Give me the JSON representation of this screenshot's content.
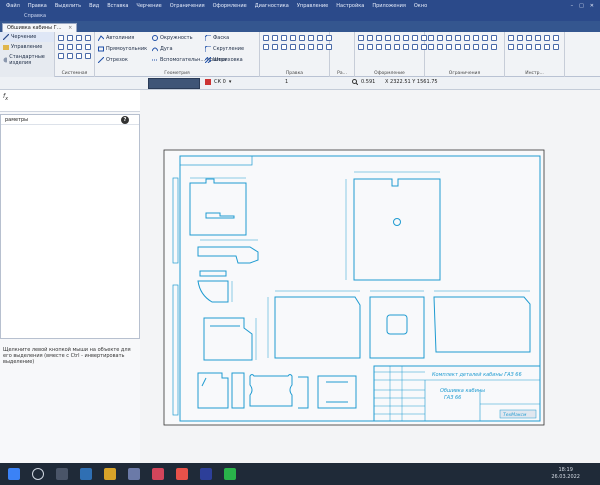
{
  "menu": {
    "items": [
      "Файл",
      "Правка",
      "Выделить",
      "Вид",
      "Вставка",
      "Черчение",
      "Ограничения",
      "Оформление",
      "Диагностика",
      "Управление",
      "Настройка",
      "Приложения",
      "Окно"
    ],
    "subtitle": "Справка"
  },
  "tab": {
    "title": "Обшивка кабины Г..."
  },
  "ribbon": {
    "mode_label": "Черчение",
    "manage_label": "Управление",
    "std_label": "Стандартные изделия",
    "group_system": "Системная",
    "autoline": "Автолиния",
    "rectangle": "Прямоугольник",
    "segment": "Отрезок",
    "circle": "Окружность",
    "arc": "Дуга",
    "aux_line": "Вспомогательн... прямая",
    "chamfer": "Фаска",
    "fillet": "Скругление",
    "hatch": "Штриховка",
    "group_geometry": "Геометрия",
    "group_edit": "Правка",
    "group_dims": "Ра...",
    "group_format": "Оформление",
    "group_constraints": "Ограничения",
    "group_tools": "Инстр..."
  },
  "toolbar2": {
    "cs_label": "СК 0",
    "step_label": "1",
    "zoom": "0.591",
    "coords": "X 2322.51   Y 1561.75"
  },
  "panel": {
    "title": "раметры",
    "hint": "Щелкните левой кнопкой мыши на объекте для его выделения (вместе с Ctrl - инвертировать выделение)"
  },
  "drawing": {
    "title_block_line1": "Комплект деталей кабины ГАЗ 66",
    "title_block_line2": "Обшивка кабины",
    "title_block_line3": "ГАЗ 66",
    "stamp_text": "ТехМаксм"
  },
  "taskbar": {
    "time": "18:19",
    "date": "26.03.2022"
  }
}
